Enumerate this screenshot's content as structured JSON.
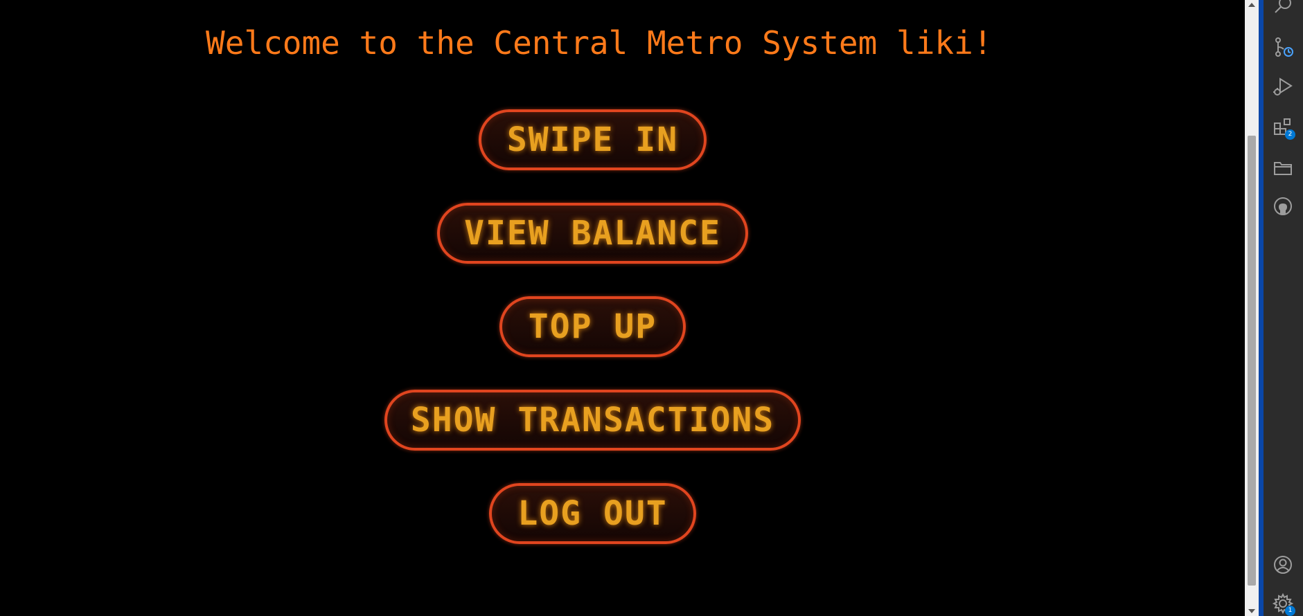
{
  "page": {
    "title": "Welcome to the Central Metro System liki!"
  },
  "menu": {
    "buttons": [
      {
        "label": "SWIPE IN"
      },
      {
        "label": "VIEW BALANCE"
      },
      {
        "label": "TOP UP"
      },
      {
        "label": "SHOW TRANSACTIONS"
      },
      {
        "label": "LOG OUT"
      }
    ]
  },
  "activity_bar": {
    "items": [
      {
        "icon": "search-icon"
      },
      {
        "icon": "source-control-icon"
      },
      {
        "icon": "run-debug-icon"
      },
      {
        "icon": "extensions-icon",
        "badge": "2"
      },
      {
        "icon": "folder-icon"
      },
      {
        "icon": "github-icon"
      },
      {
        "icon": "account-icon"
      },
      {
        "icon": "settings-gear-icon",
        "badge": "1"
      }
    ]
  },
  "colors": {
    "background": "#000000",
    "title": "#ff7a1a",
    "button_border": "#e0451f",
    "button_text": "#e8a020",
    "accent_blue": "#0078d4"
  }
}
